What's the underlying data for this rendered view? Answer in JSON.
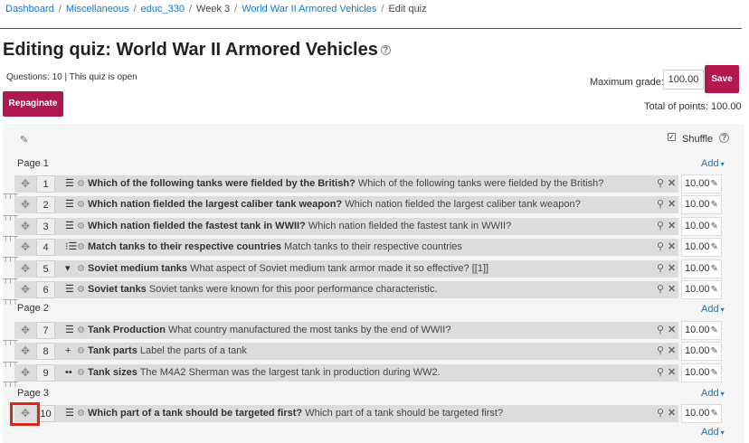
{
  "breadcrumb": [
    "Dashboard",
    "Miscellaneous",
    "educ_330",
    "Week 3",
    "World War II Armored Vehicles",
    "Edit quiz"
  ],
  "page_title": "Editing quiz: World War II Armored Vehicles",
  "status": "Questions: 10 | This quiz is open",
  "max_grade": {
    "label": "Maximum grade:",
    "value": "100.00"
  },
  "save_label": "Save",
  "repaginate_label": "Repaginate",
  "total_points": "Total of points: 100.00",
  "shuffle": {
    "label": "Shuffle",
    "checked": true
  },
  "add_label": "Add",
  "pages": [
    {
      "label": "Page 1"
    },
    {
      "label": "Page 2"
    },
    {
      "label": "Page 3"
    }
  ],
  "questions": [
    {
      "num": "1",
      "type_icon": "multichoice-icon",
      "name": "Which of the following tanks were fielded by the British?",
      "text": "Which of the following tanks were fielded by the British?",
      "mark": "10.00"
    },
    {
      "num": "2",
      "type_icon": "multichoice-icon",
      "name": "Which nation fielded the largest caliber tank weapon?",
      "text": "Which nation fielded the largest caliber tank weapon?",
      "mark": "10.00"
    },
    {
      "num": "3",
      "type_icon": "multichoice-icon",
      "name": "Which nation fielded the fastest tank in WWII?",
      "text": "Which nation fielded the fastest tank in WWII?",
      "mark": "10.00"
    },
    {
      "num": "4",
      "type_icon": "matching-icon",
      "name": "Match tanks to their respective countries",
      "text": "Match tanks to their respective countries",
      "mark": "10.00"
    },
    {
      "num": "5",
      "type_icon": "select-missing-words-icon",
      "name": "Soviet medium tanks",
      "text": "What aspect of Soviet medium tank armor made it so effective? [[1]]",
      "mark": "10.00"
    },
    {
      "num": "6",
      "type_icon": "multichoice-icon",
      "name": "Soviet tanks",
      "text": "Soviet tanks were known for this poor performance characteristic.",
      "mark": "10.00"
    },
    {
      "num": "7",
      "type_icon": "multichoice-icon",
      "name": "Tank Production",
      "text": "What country manufactured the most tanks by the end of WWII?",
      "mark": "10.00"
    },
    {
      "num": "8",
      "type_icon": "drag-drop-markers-icon",
      "name": "Tank parts",
      "text": "Label the parts of a tank",
      "mark": "10.00"
    },
    {
      "num": "9",
      "type_icon": "true-false-icon",
      "name": "Tank sizes",
      "text": "The M4A2 Sherman was the largest tank in production during WW2.",
      "mark": "10.00"
    },
    {
      "num": "10",
      "type_icon": "multichoice-icon",
      "name": "Which part of a tank should be targeted first?",
      "text": "Which part of a tank should be targeted first?",
      "mark": "10.00"
    }
  ],
  "colors": {
    "accent": "#b0184f",
    "link": "#1177d1",
    "row_bg": "#dcdcdc",
    "highlight": "#e2231a"
  }
}
